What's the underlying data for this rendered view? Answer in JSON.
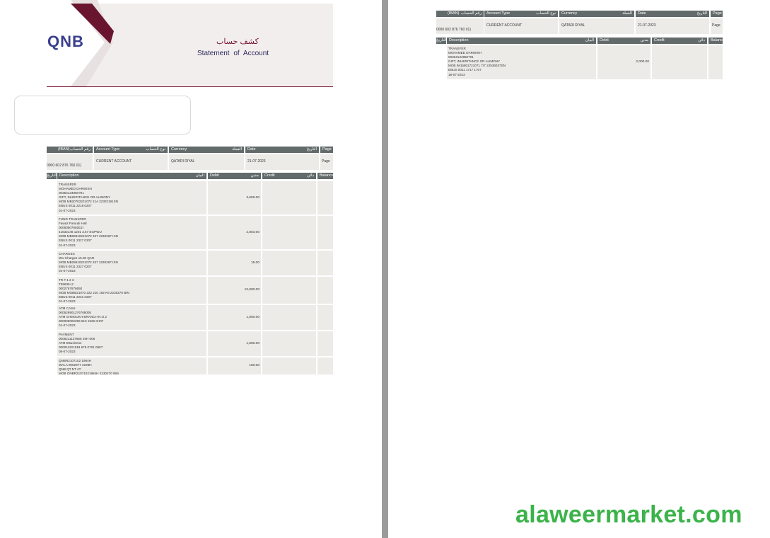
{
  "header": {
    "logo_text": "QNB",
    "title_ar": "كشف حساب",
    "title_en": "Statement of Account"
  },
  "account_table": {
    "headers": [
      {
        "en": "(IBAN)",
        "ar": "رقم الحساب"
      },
      {
        "en": "Account Type",
        "ar": "نوع الحساب"
      },
      {
        "en": "Currency",
        "ar": "العملة"
      },
      {
        "en": "Date",
        "ar": "التاريخ"
      },
      {
        "en": "Page",
        "ar": ""
      }
    ],
    "left_values": [
      "0000 602 876 760 01)",
      "CURRENT ACCOUNT",
      "QATARI RIYAL",
      "21-07-2023",
      "Page"
    ],
    "right_values": [
      "0000 602 876 760 01)",
      "CURRENT ACCOUNT",
      "QATARI RIYAL",
      "21-07-2023",
      "Page"
    ]
  },
  "txn_headers": {
    "date_ar": "التاريخ",
    "description": "Description",
    "description_ar": "البيان",
    "debit": "Debit",
    "debit_ar": "مدين",
    "credit": "Credit",
    "credit_ar": "دائن",
    "balance": "Balance"
  },
  "left_transactions": [
    {
      "lines": [
        "TRANSFER",
        "MOHAMED DARWISH",
        "00354134950?01",
        "GIFT, INHERITANCE OR ALIMONY",
        "MOB MB20702221072 21A   22302191SN",
        "EBUS 0011 2218 0207",
        "01-07-2023"
      ],
      "debit": "3,609.00"
    },
    {
      "lines": [
        "FUND TRANSFER",
        "Fawaz Faroudi Hall",
        "00060607692EJI",
        "41632146 1201 3,57 EGPWU",
        "MOB MB29610221072 327   2230267 HIN",
        "EBUS 0011 2327 0207",
        "01-07-2023"
      ],
      "debit": "2,803.00"
    },
    {
      "lines": [
        "CHARGES",
        "WU Charges 15.00 QAR",
        "MOB MB29610221072 327   2230267 ISN",
        "EBUS 0011 2327 0207",
        "01-07-2023"
      ],
      "debit": "15.00"
    },
    {
      "lines": [
        "TR # 1 2 3",
        "T55635+2",
        "0002767676650",
        "MOB MOBB21070 222 210 192 K6   2230270 BIN",
        "EBUS 0011 2231 0207",
        "01-07-2023"
      ],
      "debit": "10,000.00"
    },
    {
      "lines": [
        "ATM CASH",
        "000529901276769005",
        "ATM SHMOUKH BRANCH N.O.2",
        "000006002296 610 1926 0H07",
        "01-07-2023"
      ],
      "debit": "1,000.00"
    },
    {
      "lines": [
        "PAYMENT",
        "0005211137665 29H 006",
        "ATM EBusiness",
        "000011221918 678 0701 0807",
        "08-07-2023"
      ],
      "debit": "1,500.00"
    },
    {
      "lines": [
        "QNBR2107102 1984H",
        "WALA 0002977 3198H",
        "QNB QT NT AT",
        "MOB QNBR21071021984H   2230270 09S"
      ],
      "debit": "150.00"
    }
  ],
  "right_transactions": [
    {
      "lines": [
        "TRANSFER",
        "MOHAMED DARWISH",
        "00354134950?01",
        "GIFT, INHERITANCE OR ALIMONY",
        "MOB IM15801721071 7r7   22536037SN",
        "EBUS 0011 1717 1707",
        "18-07-2023"
      ],
      "debit": "2,000.00"
    }
  ],
  "watermark": "alaweermarket.com",
  "colors": {
    "header_fill": "#626a6a",
    "cell_fill": "#ecebe8",
    "brand_maroon": "#7a1a36",
    "watermark_green": "#3bb34a"
  }
}
